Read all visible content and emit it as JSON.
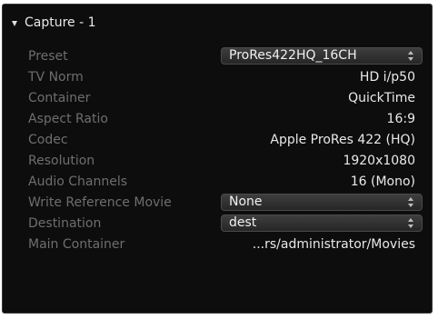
{
  "section": {
    "title": "Capture - 1"
  },
  "rows": {
    "preset": {
      "label": "Preset",
      "value": "ProRes422HQ_16CH"
    },
    "tv_norm": {
      "label": "TV Norm",
      "value": "HD i/p50"
    },
    "container": {
      "label": "Container",
      "value": "QuickTime"
    },
    "aspect_ratio": {
      "label": "Aspect Ratio",
      "value": "16:9"
    },
    "codec": {
      "label": "Codec",
      "value": "Apple ProRes 422 (HQ)"
    },
    "resolution": {
      "label": "Resolution",
      "value": "1920x1080"
    },
    "audio_channels": {
      "label": "Audio Channels",
      "value": "16 (Mono)"
    },
    "write_reference_movie": {
      "label": "Write Reference Movie",
      "value": "None"
    },
    "destination": {
      "label": "Destination",
      "value": "dest"
    },
    "main_container": {
      "label": "Main Container",
      "value": "...rs/administrator/Movies"
    }
  },
  "colors": {
    "panel_background": "#0d0d0d",
    "label_text": "#6e6e6e",
    "value_text": "#e9e9e9"
  },
  "icons": {
    "disclosure": "disclosure-triangle-down-icon",
    "stepper": "up-down-stepper-icon"
  }
}
